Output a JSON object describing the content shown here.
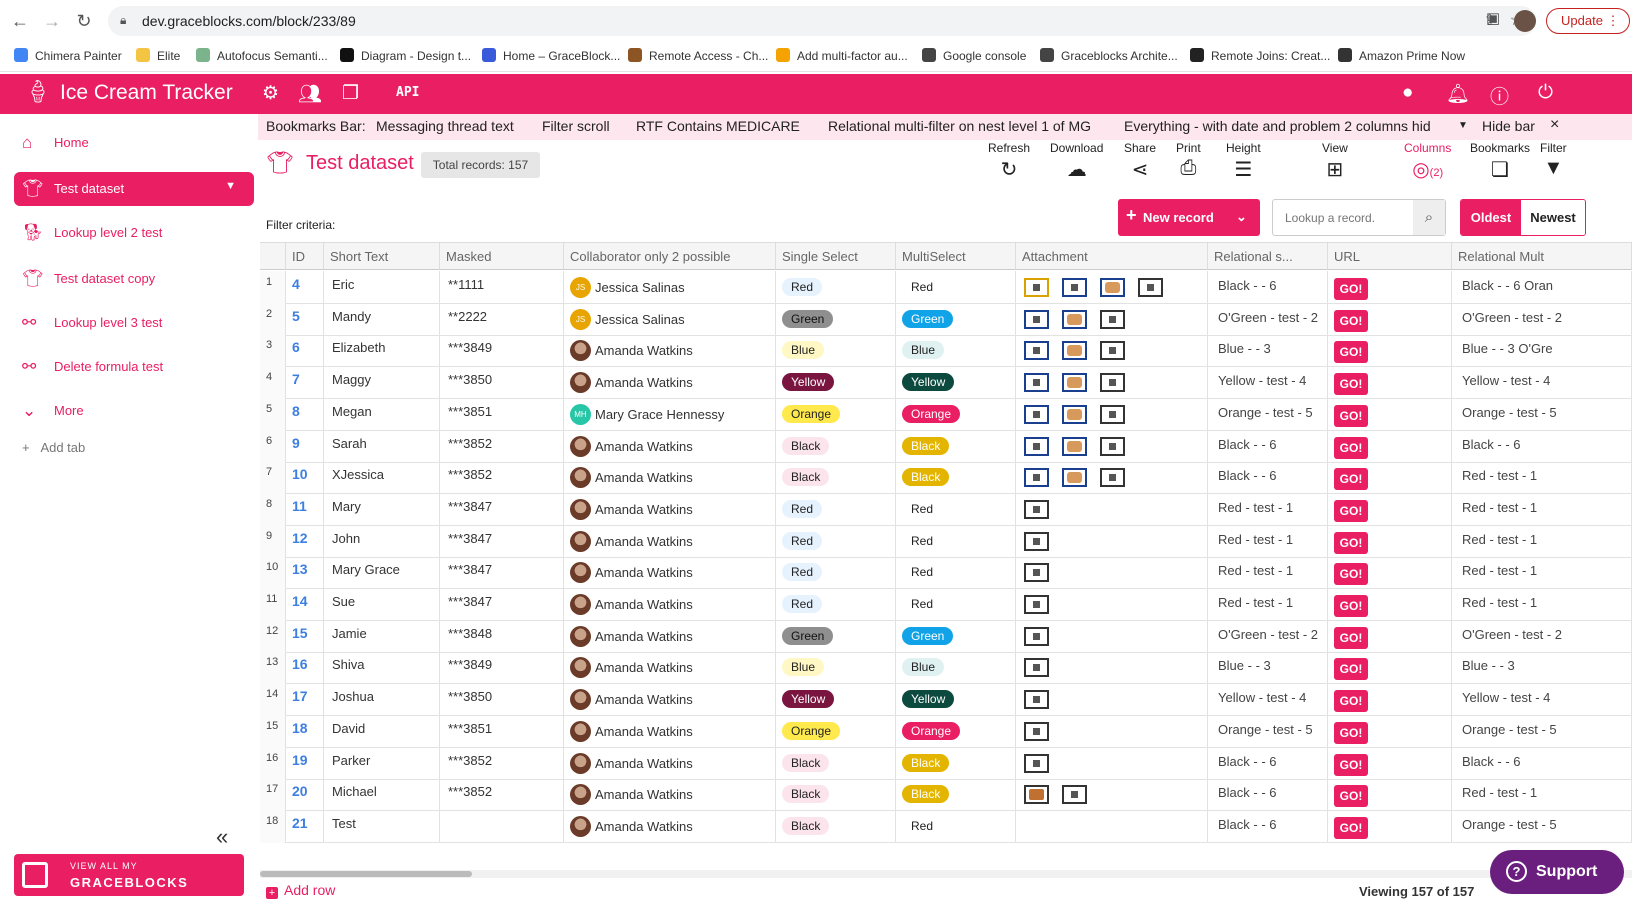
{
  "browser": {
    "url": "dev.graceblocks.com/block/233/89",
    "update_label": "Update",
    "bookmarks": [
      {
        "label": "Chimera Painter",
        "color": "#4285f4"
      },
      {
        "label": "Elite",
        "color": "#f4c542"
      },
      {
        "label": "Autofocus Semanti...",
        "color": "#7bb38c"
      },
      {
        "label": "Diagram - Design t...",
        "color": "#111111"
      },
      {
        "label": "Home – GraceBlock...",
        "color": "#3a5bd9"
      },
      {
        "label": "Remote Access - Ch...",
        "color": "#8d5524"
      },
      {
        "label": "Add multi-factor au...",
        "color": "#f4a300"
      },
      {
        "label": "Google console",
        "color": "#444444"
      },
      {
        "label": "Graceblocks Archite...",
        "color": "#444444"
      },
      {
        "label": "Remote Joins: Creat...",
        "color": "#222222"
      },
      {
        "label": "Amazon Prime Now",
        "color": "#333333"
      }
    ]
  },
  "app": {
    "title": "Ice Cream Tracker",
    "api_label": "API",
    "accent": "#e91e63"
  },
  "sidebar": {
    "items": [
      {
        "label": "Home",
        "icon": "home-icon"
      },
      {
        "label": "Test dataset",
        "icon": "shirt-icon",
        "active": true
      },
      {
        "label": "Lookup level 2 test",
        "icon": "dog-icon"
      },
      {
        "label": "Test dataset copy",
        "icon": "shirt-icon"
      },
      {
        "label": "Lookup level 3 test",
        "icon": "bone-icon"
      },
      {
        "label": "Delete formula test",
        "icon": "bone-icon"
      },
      {
        "label": "More",
        "icon": "chevron-down-icon"
      }
    ],
    "add_tab": "Add tab",
    "banner_line1": "VIEW ALL MY",
    "banner_line2": "GRACEBLOCKS"
  },
  "bookmarks_ribbon": {
    "label": "Bookmarks Bar:",
    "items": [
      "Messaging thread text",
      "Filter scroll",
      "RTF Contains MEDICARE",
      "Relational multi-filter on nest level 1 of MG",
      "Everything - with date and problem 2 columns hid"
    ],
    "hide_label": "Hide bar"
  },
  "dataset": {
    "title": "Test dataset",
    "total_records": "Total records: 157",
    "filter_criteria": "Filter criteria:",
    "new_record": "New record",
    "lookup_placeholder": "Lookup a record.",
    "oldest": "Oldest",
    "newest": "Newest",
    "add_row": "Add row",
    "viewing": "Viewing 157 of 157",
    "support": "Support"
  },
  "toolbar": {
    "refresh": "Refresh",
    "download": "Download",
    "share": "Share",
    "print": "Print",
    "height": "Height",
    "view": "View",
    "columns": "Columns",
    "columns_count": "(2)",
    "bookmarks": "Bookmarks",
    "filter": "Filter"
  },
  "table": {
    "columns": [
      "ID",
      "Short Text",
      "Masked",
      "Collaborator only 2 possible",
      "Single Select",
      "MultiSelect",
      "Attachment",
      "Relational s...",
      "URL",
      "Relational Mult"
    ],
    "go_label": "GO!",
    "colors": {
      "Red": {
        "bg": "#e6f2fd",
        "fg": "#222222"
      },
      "Green": {
        "bg": "#8f8f8f",
        "fg": "#111111"
      },
      "Blue": {
        "bg": "#fff8c4",
        "fg": "#222222"
      },
      "Yellow": {
        "bg": "#7a1540",
        "fg": "#ffffff"
      },
      "Orange": {
        "bg": "#ffe94d",
        "fg": "#222222"
      },
      "Black": {
        "bg": "#fce4ec",
        "fg": "#222222"
      }
    },
    "multi_colors": {
      "Red": {
        "bg": "transparent",
        "fg": "#222222"
      },
      "Green": {
        "bg": "#11a3e8",
        "fg": "#ffffff"
      },
      "Blue": {
        "bg": "#dff1f1",
        "fg": "#222222"
      },
      "Yellow": {
        "bg": "#0c4a3f",
        "fg": "#ffffff"
      },
      "Orange": {
        "bg": "#e91e63",
        "fg": "#ffffff"
      },
      "Black": {
        "bg": "#e3b500",
        "fg": "#ffffff"
      }
    },
    "rows": [
      {
        "n": "1",
        "id": "4",
        "text": "Eric",
        "masked": "**1111",
        "collab": "Jessica Salinas",
        "av": "JS",
        "single": "Red",
        "multi": "Red",
        "att": "A",
        "rel": "Black - - 6",
        "relm": "Black - - 6   Oran"
      },
      {
        "n": "2",
        "id": "5",
        "text": "Mandy",
        "masked": "**2222",
        "collab": "Jessica Salinas",
        "av": "JS",
        "single": "Green",
        "multi": "Green",
        "att": "B",
        "rel": "O'Green - test - 2",
        "relm": "O'Green - test - 2"
      },
      {
        "n": "3",
        "id": "6",
        "text": "Elizabeth",
        "masked": "***3849",
        "collab": "Amanda Watkins",
        "av": "",
        "single": "Blue",
        "multi": "Blue",
        "att": "B",
        "rel": "Blue - - 3",
        "relm": "Blue - - 3   O'Gre"
      },
      {
        "n": "4",
        "id": "7",
        "text": "Maggy",
        "masked": "***3850",
        "collab": "Amanda Watkins",
        "av": "",
        "single": "Yellow",
        "multi": "Yellow",
        "att": "B",
        "rel": "Yellow - test - 4",
        "relm": "Yellow - test - 4"
      },
      {
        "n": "5",
        "id": "8",
        "text": "Megan",
        "masked": "***3851",
        "collab": "Mary Grace Hennessy",
        "av": "MH",
        "single": "Orange",
        "multi": "Orange",
        "att": "B",
        "rel": "Orange - test - 5",
        "relm": "Orange - test - 5"
      },
      {
        "n": "6",
        "id": "9",
        "text": "Sarah",
        "masked": "***3852",
        "collab": "Amanda Watkins",
        "av": "",
        "single": "Black",
        "multi": "Black",
        "att": "B",
        "rel": "Black - - 6",
        "relm": "Black - - 6"
      },
      {
        "n": "7",
        "id": "10",
        "text": "XJessica",
        "masked": "***3852",
        "collab": "Amanda Watkins",
        "av": "",
        "single": "Black",
        "multi": "Black",
        "att": "B",
        "rel": "Black - - 6",
        "relm": "Red - test - 1"
      },
      {
        "n": "8",
        "id": "11",
        "text": "Mary",
        "masked": "***3847",
        "collab": "Amanda Watkins",
        "av": "",
        "single": "Red",
        "multi": "Red",
        "att": "C",
        "rel": "Red - test - 1",
        "relm": "Red - test - 1"
      },
      {
        "n": "9",
        "id": "12",
        "text": "John",
        "masked": "***3847",
        "collab": "Amanda Watkins",
        "av": "",
        "single": "Red",
        "multi": "Red",
        "att": "C",
        "rel": "Red - test - 1",
        "relm": "Red - test - 1"
      },
      {
        "n": "10",
        "id": "13",
        "text": "Mary Grace",
        "masked": "***3847",
        "collab": "Amanda Watkins",
        "av": "",
        "single": "Red",
        "multi": "Red",
        "att": "C",
        "rel": "Red - test - 1",
        "relm": "Red - test - 1"
      },
      {
        "n": "11",
        "id": "14",
        "text": "Sue",
        "masked": "***3847",
        "collab": "Amanda Watkins",
        "av": "",
        "single": "Red",
        "multi": "Red",
        "att": "C",
        "rel": "Red - test - 1",
        "relm": "Red - test - 1"
      },
      {
        "n": "12",
        "id": "15",
        "text": "Jamie",
        "masked": "***3848",
        "collab": "Amanda Watkins",
        "av": "",
        "single": "Green",
        "multi": "Green",
        "att": "C",
        "rel": "O'Green - test - 2",
        "relm": "O'Green - test - 2"
      },
      {
        "n": "13",
        "id": "16",
        "text": "Shiva",
        "masked": "***3849",
        "collab": "Amanda Watkins",
        "av": "",
        "single": "Blue",
        "multi": "Blue",
        "att": "C",
        "rel": "Blue - - 3",
        "relm": "Blue - - 3"
      },
      {
        "n": "14",
        "id": "17",
        "text": "Joshua",
        "masked": "***3850",
        "collab": "Amanda Watkins",
        "av": "",
        "single": "Yellow",
        "multi": "Yellow",
        "att": "C",
        "rel": "Yellow - test - 4",
        "relm": "Yellow - test - 4"
      },
      {
        "n": "15",
        "id": "18",
        "text": "David",
        "masked": "***3851",
        "collab": "Amanda Watkins",
        "av": "",
        "single": "Orange",
        "multi": "Orange",
        "att": "C",
        "rel": "Orange - test - 5",
        "relm": "Orange - test - 5"
      },
      {
        "n": "16",
        "id": "19",
        "text": "Parker",
        "masked": "***3852",
        "collab": "Amanda Watkins",
        "av": "",
        "single": "Black",
        "multi": "Black",
        "att": "C",
        "rel": "Black - - 6",
        "relm": "Black - - 6"
      },
      {
        "n": "17",
        "id": "20",
        "text": "Michael",
        "masked": "***3852",
        "collab": "Amanda Watkins",
        "av": "",
        "single": "Black",
        "multi": "Black",
        "att": "D",
        "rel": "Black - - 6",
        "relm": "Red - test - 1"
      },
      {
        "n": "18",
        "id": "21",
        "text": "Test",
        "masked": "",
        "collab": "Amanda Watkins",
        "av": "",
        "single": "Black",
        "multi": "Red",
        "att": "",
        "rel": "Black - - 6",
        "relm": "Orange - test - 5"
      }
    ]
  }
}
